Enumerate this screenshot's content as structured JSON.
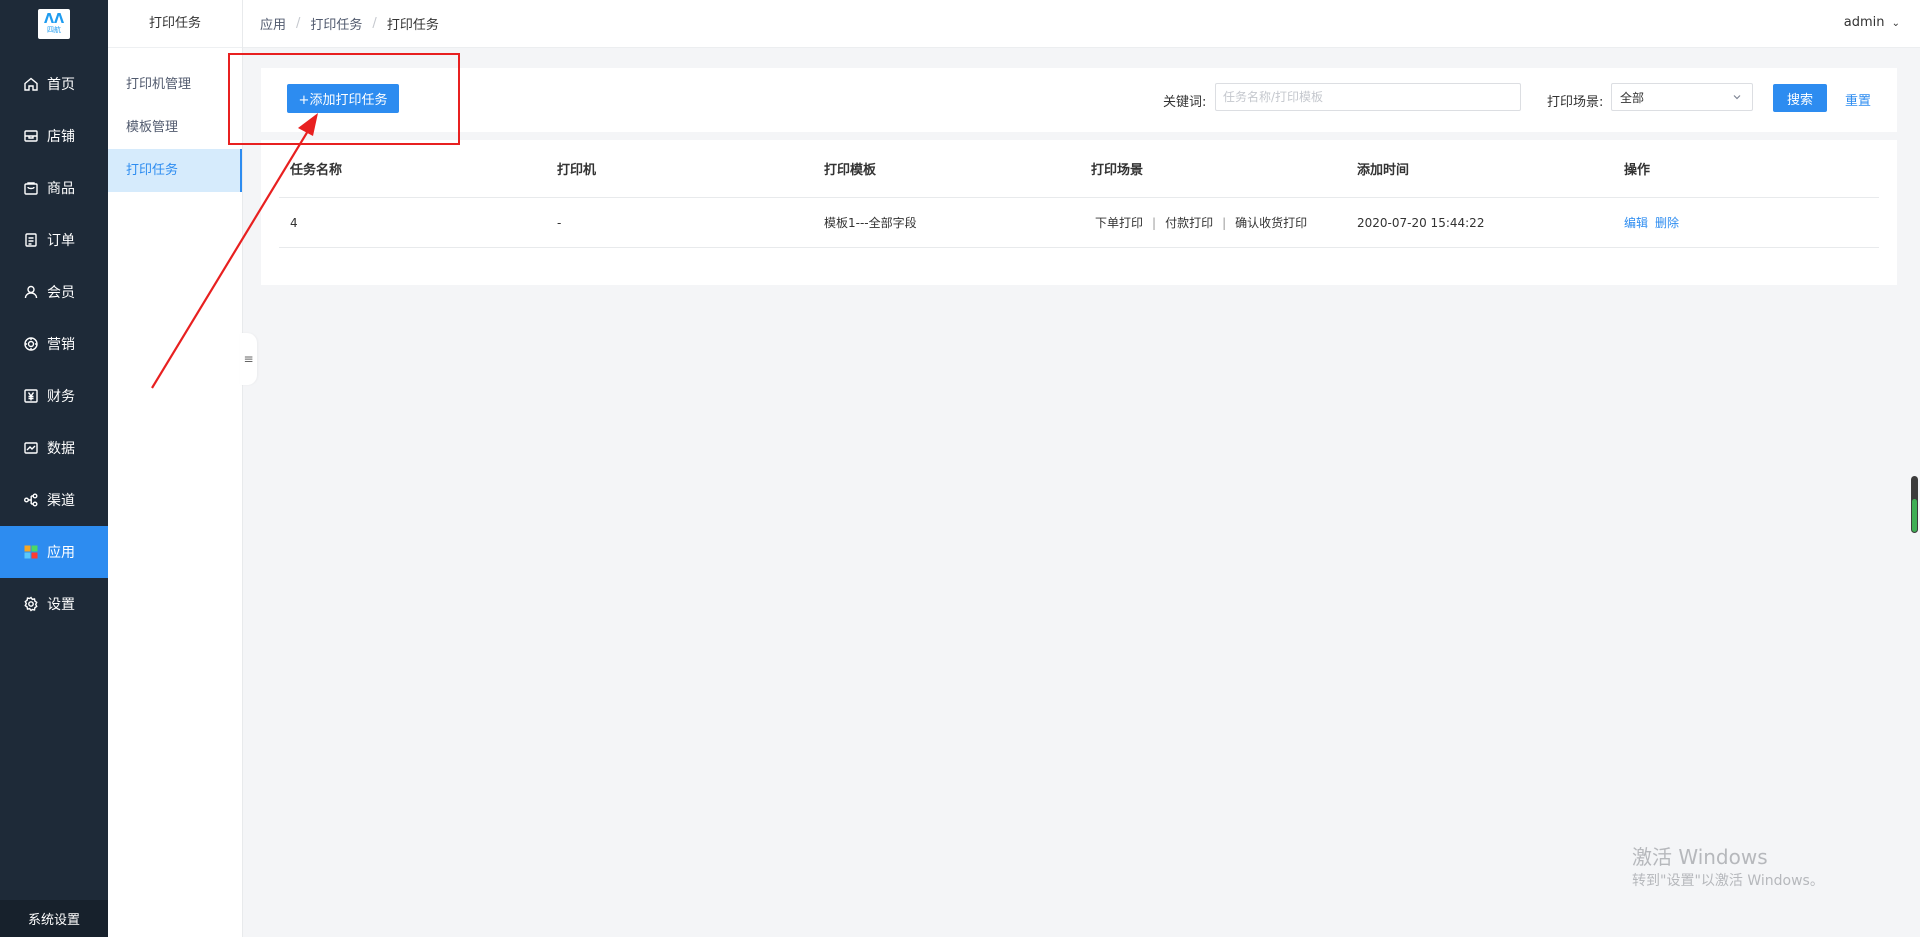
{
  "logo": {
    "brand_icon": "m-logo-icon",
    "text": "四航"
  },
  "sidebar": {
    "items": [
      {
        "label": "首页",
        "icon": "home-icon",
        "active": false
      },
      {
        "label": "店铺",
        "icon": "store-icon",
        "active": false
      },
      {
        "label": "商品",
        "icon": "goods-icon",
        "active": false
      },
      {
        "label": "订单",
        "icon": "order-icon",
        "active": false
      },
      {
        "label": "会员",
        "icon": "member-icon",
        "active": false
      },
      {
        "label": "营销",
        "icon": "marketing-icon",
        "active": false
      },
      {
        "label": "财务",
        "icon": "finance-icon",
        "active": false
      },
      {
        "label": "数据",
        "icon": "data-icon",
        "active": false
      },
      {
        "label": "渠道",
        "icon": "channel-icon",
        "active": false
      },
      {
        "label": "应用",
        "icon": "app-grid-icon",
        "active": true
      },
      {
        "label": "设置",
        "icon": "settings-icon",
        "active": false
      }
    ],
    "bottom_label": "系统设置"
  },
  "subsidebar": {
    "title": "打印任务",
    "items": [
      {
        "label": "打印机管理",
        "active": false
      },
      {
        "label": "模板管理",
        "active": false
      },
      {
        "label": "打印任务",
        "active": true
      }
    ],
    "collapse_icon": "collapse-menu-icon"
  },
  "header": {
    "breadcrumb": [
      "应用",
      "打印任务",
      "打印任务"
    ],
    "separator": "/",
    "user": "admin"
  },
  "toolbar": {
    "add_button": "+添加打印任务",
    "keyword_label": "关键词:",
    "keyword_value": "",
    "keyword_placeholder": "任务名称/打印模板",
    "scene_label": "打印场景:",
    "scene_selected": "全部",
    "search_button": "搜索",
    "reset_link": "重置"
  },
  "table": {
    "columns": [
      "任务名称",
      "打印机",
      "打印模板",
      "打印场景",
      "添加时间",
      "操作"
    ],
    "rows": [
      {
        "name": "4",
        "printer": "-",
        "template": "模板1---全部字段",
        "scenes": [
          "下单打印",
          "付款打印",
          "确认收货打印"
        ],
        "added_at": "2020-07-20 15:44:22",
        "actions": [
          "编辑",
          "删除"
        ]
      }
    ],
    "scene_separator": "|"
  },
  "annotation": {
    "color": "#e82020"
  },
  "watermark": {
    "line1": "激活 Windows",
    "line2": "转到\"设置\"以激活 Windows。"
  },
  "colors": {
    "primary": "#2d8cf0",
    "sidebar_bg": "#1e2a38",
    "sub_active_bg": "#d6ebfc"
  }
}
